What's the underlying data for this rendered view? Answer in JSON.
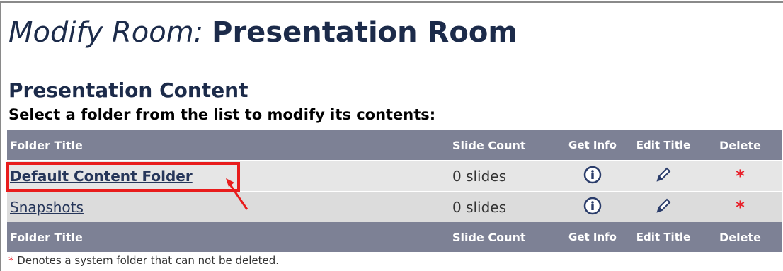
{
  "page": {
    "title_prefix": "Modify Room:",
    "room_name": "Presentation Room"
  },
  "section": {
    "title": "Presentation Content",
    "instruction": "Select a folder from the list to modify its contents:"
  },
  "table": {
    "headers": {
      "folder_title": "Folder Title",
      "slide_count": "Slide Count",
      "get_info": "Get Info",
      "edit_title": "Edit Title",
      "delete": "Delete"
    },
    "rows": [
      {
        "folder_title": "Default Content Folder",
        "slide_count": "0 slides",
        "delete_mark": "*"
      },
      {
        "folder_title": "Snapshots",
        "slide_count": "0 slides",
        "delete_mark": "*"
      }
    ]
  },
  "footnote": {
    "marker": "*",
    "text": " Denotes a system folder that can not be deleted."
  },
  "icons": {
    "get_info": "info-icon",
    "edit_title": "pencil-icon",
    "annotation_arrow": "arrow-icon"
  },
  "colors": {
    "header_bg": "#7d8195",
    "title_text": "#1c2b4a",
    "highlight": "#e81c1c",
    "asterisk": "#e8202a"
  }
}
